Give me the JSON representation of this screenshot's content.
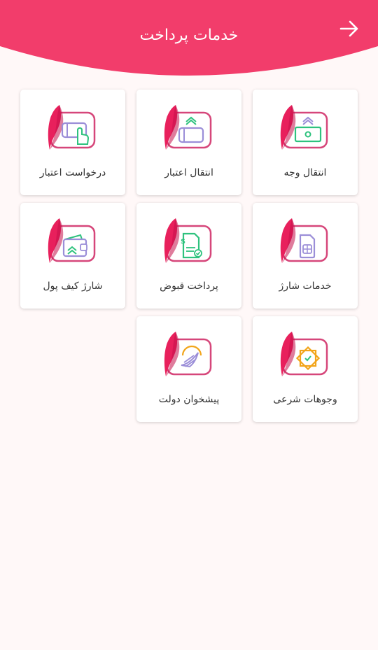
{
  "header": {
    "title": "خدمات پرداخت",
    "color": "#f23d6b"
  },
  "services": [
    {
      "label": "انتقال وجه",
      "icon": "money-transfer-icon"
    },
    {
      "label": "انتقال اعتبار",
      "icon": "credit-transfer-icon"
    },
    {
      "label": "درخواست اعتبار",
      "icon": "credit-request-icon"
    },
    {
      "label": "خدمات شارژ",
      "icon": "sim-charge-icon"
    },
    {
      "label": "پرداخت قبوض",
      "icon": "bill-payment-icon"
    },
    {
      "label": "شارژ کیف پول",
      "icon": "wallet-charge-icon"
    },
    {
      "label": "وجوهات شرعی",
      "icon": "religious-funds-icon"
    },
    {
      "label": "پیشخوان دولت",
      "icon": "government-counter-icon"
    }
  ]
}
